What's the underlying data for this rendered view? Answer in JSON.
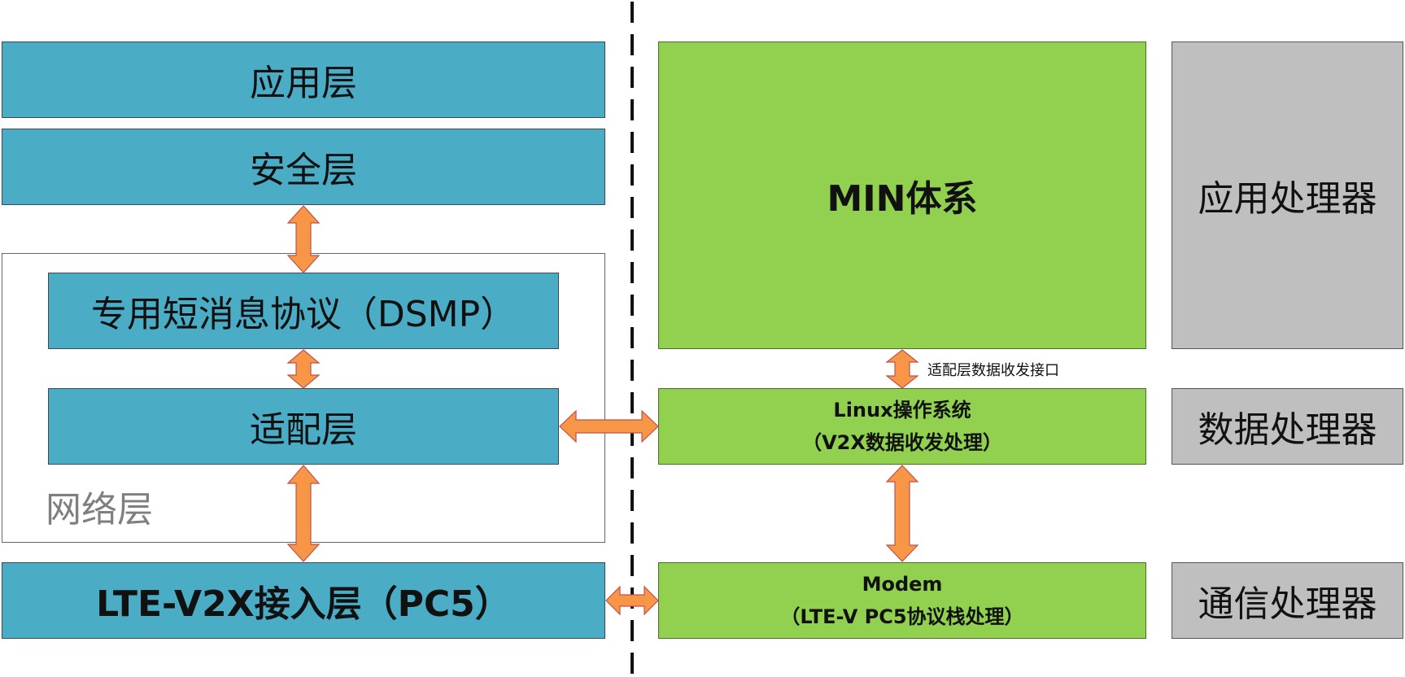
{
  "colors": {
    "left_blocks": "#4bacc6",
    "right_blocks": "#92d050",
    "processors": "#bfbfbf",
    "arrows": "#f79646"
  },
  "left": {
    "app_layer": "应用层",
    "security_layer": "安全层",
    "dsmp": "专用短消息协议（DSMP）",
    "adaptation_layer": "适配层",
    "network_layer": "网络层",
    "access_layer": "LTE-V2X接入层（PC5）"
  },
  "right": {
    "min_system": "MIN体系",
    "adapter_interface": "适配层数据收发接口",
    "linux_line1": "Linux操作系统",
    "linux_line2": "（V2X数据收发处理）",
    "modem_line1": "Modem",
    "modem_line2": "（LTE-V PC5协议栈处理）"
  },
  "processors": {
    "app": "应用处理器",
    "data": "数据处理器",
    "comm": "通信处理器"
  }
}
